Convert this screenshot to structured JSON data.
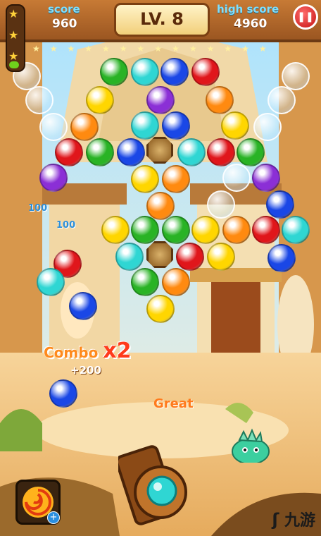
{
  "hud": {
    "score_label": "score",
    "score_value": "960",
    "level_label": "LV. 8",
    "high_score_label": "high score",
    "high_score_value": "4960"
  },
  "star_meter": {
    "progress": 0.12,
    "stars": 3
  },
  "popups": {
    "points_a": "100",
    "points_b": "100",
    "combo_label": "Combo",
    "combo_mult": "x2",
    "combo_points": "+200",
    "great": "Great"
  },
  "watermark": "九游",
  "colors": {
    "red": "#e0161b",
    "orange": "#ff8a10",
    "yellow": "#ffd600",
    "green": "#29b325",
    "cyan": "#2fd6d3",
    "blue": "#1a47e6",
    "purple": "#8b2fd6"
  }
}
